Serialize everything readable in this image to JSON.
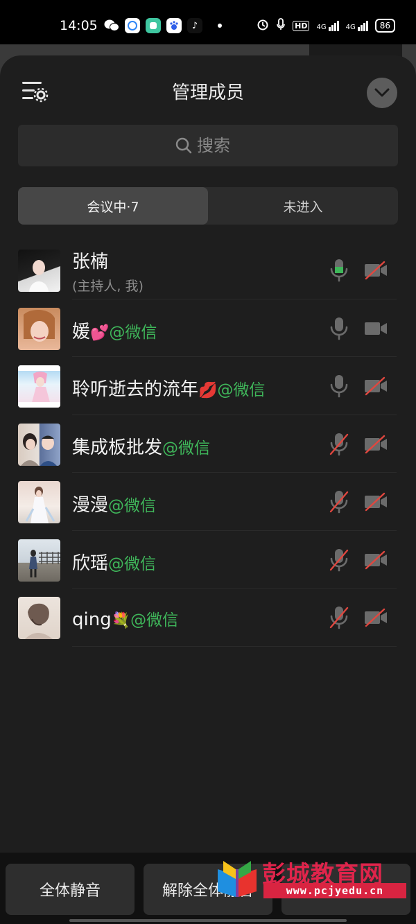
{
  "status_bar": {
    "time": "14:05",
    "app_icons": [
      "wechat-icon",
      "chat-bubble-icon",
      "notes-app-icon",
      "baidu-paw-icon",
      "tiktok-icon"
    ],
    "battery": "86",
    "hd_label": "HD",
    "network": "4G"
  },
  "sheet": {
    "title": "管理成员",
    "search_placeholder": "搜索",
    "tabs": [
      {
        "label": "会议中·7",
        "active": true
      },
      {
        "label": "未进入",
        "active": false
      }
    ]
  },
  "members": [
    {
      "name": "张楠",
      "sub": "(主持人, 我)",
      "tag": "",
      "emoji": "",
      "mic": "on-active",
      "camera": "off"
    },
    {
      "name": "媛",
      "sub": "",
      "tag": "@微信",
      "emoji": "💕",
      "mic": "on",
      "camera": "on"
    },
    {
      "name": "聆听逝去的流年",
      "sub": "",
      "tag": "@微信",
      "emoji": "💋",
      "mic": "on",
      "camera": "off"
    },
    {
      "name": "集成板批发",
      "sub": "",
      "tag": "@微信",
      "emoji": "",
      "mic": "off",
      "camera": "off"
    },
    {
      "name": "漫漫",
      "sub": "",
      "tag": "@微信",
      "emoji": "",
      "mic": "off",
      "camera": "off"
    },
    {
      "name": "欣瑶",
      "sub": "",
      "tag": "@微信",
      "emoji": "",
      "mic": "off",
      "camera": "off"
    },
    {
      "name": "qing",
      "sub": "",
      "tag": "@微信",
      "emoji": "💐",
      "mic": "off",
      "camera": "off"
    }
  ],
  "bottom_bar": {
    "mute_all": "全体静音",
    "unmute_all": "解除全体静音"
  },
  "watermark": {
    "title": "彭城教育网",
    "url": "www.pcjyedu.cn"
  },
  "colors": {
    "accent_green": "#3fb65a",
    "muted_red": "#e0473f",
    "sheet_bg": "#1e1e1e"
  }
}
